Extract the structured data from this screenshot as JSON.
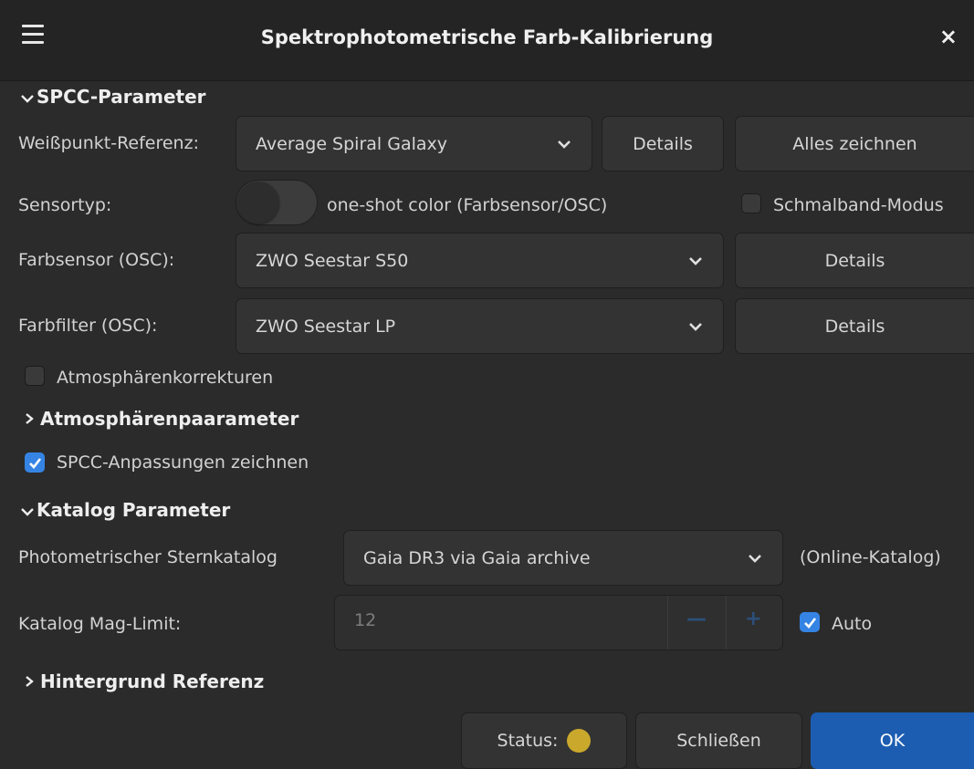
{
  "window": {
    "title": "Spektrophotometrische Farb-Kalibrierung",
    "close_glyph": "×"
  },
  "spcc": {
    "section_label": "SPCC-Parameter",
    "whitepoint_label": "Weißpunkt-Referenz:",
    "whitepoint_value": "Average Spiral Galaxy",
    "whitepoint_details": "Details",
    "plot_all": "Alles zeichnen",
    "sensor_type_label": "Sensortyp:",
    "sensor_type_value": "one-shot color (Farbsensor/OSC)",
    "narrowband_label": "Schmalband-Modus",
    "narrowband_checked": false,
    "osc_sensor_label": "Farbsensor (OSC):",
    "osc_sensor_value": "ZWO Seestar S50",
    "osc_sensor_details": "Details",
    "osc_filter_label": "Farbfilter (OSC):",
    "osc_filter_value": "ZWO Seestar LP",
    "osc_filter_details": "Details",
    "atmos_corr_label": "Atmosphärenkorrekturen",
    "atmos_corr_checked": false,
    "atmos_params_label": "Atmosphärenpaarameter",
    "plot_fits_label": "SPCC-Anpassungen zeichnen",
    "plot_fits_checked": true
  },
  "catalog": {
    "section_label": "Katalog Parameter",
    "photometric_label": "Photometrischer Sternkatalog",
    "photometric_value": "Gaia DR3 via Gaia archive",
    "online_label": "(Online-Katalog)",
    "maglimit_label": "Katalog Mag-Limit:",
    "maglimit_value": "12",
    "auto_label": "Auto",
    "auto_checked": true
  },
  "background": {
    "section_label": "Hintergrund Referenz"
  },
  "footer": {
    "status_label": "Status:",
    "status_color": "#c9a82c",
    "close_label": "Schließen",
    "ok_label": "OK"
  },
  "colors": {
    "accent": "#3584e4",
    "ok_button": "#1c5db1",
    "background": "#2b2b2b"
  }
}
